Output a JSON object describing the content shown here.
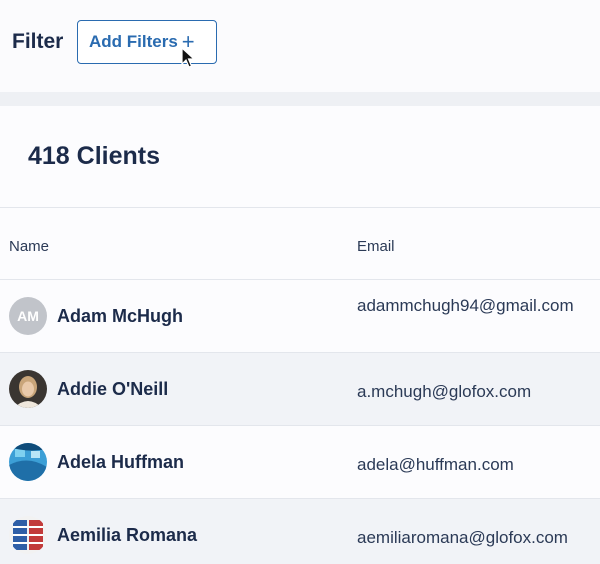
{
  "filter": {
    "label": "Filter",
    "add_button_label": "Add Filters",
    "add_button_icon": "plus-icon"
  },
  "clients": {
    "count_label": "418 Clients"
  },
  "table": {
    "columns": [
      "Name",
      "Email"
    ],
    "rows": [
      {
        "initials": "AM",
        "name": "Adam McHugh",
        "email": "adammchugh94@gmail.com",
        "avatar": "initials"
      },
      {
        "initials": "",
        "name": "Addie O'Neill",
        "email": "a.mchugh@glofox.com",
        "avatar": "photo-woman"
      },
      {
        "initials": "",
        "name": "Adela Huffman",
        "email": "adela@huffman.com",
        "avatar": "photo-pool"
      },
      {
        "initials": "",
        "name": "Aemilia Romana",
        "email": "aemiliaromana@glofox.com",
        "avatar": "photo-stadium"
      }
    ]
  },
  "colors": {
    "accent": "#2a6bb0",
    "text": "#1c2b4a",
    "row_alt": "#f1f3f7"
  }
}
